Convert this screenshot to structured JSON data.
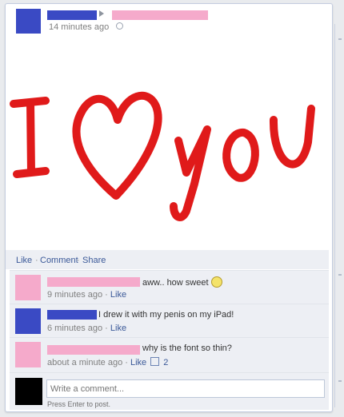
{
  "post": {
    "timestamp": "14 minutes ago",
    "icon_audience": "globe-icon"
  },
  "photo": {
    "drawn_text_left": "I",
    "drawn_text_right": "you",
    "heart_icon": "heart-icon",
    "ink_color": "#e01a1a"
  },
  "actions": {
    "like": "Like",
    "comment": "Comment",
    "share": "Share",
    "separator": "·"
  },
  "comments": [
    {
      "text": "aww.. how sweet",
      "meta_time": "9 minutes ago",
      "meta_like": "Like",
      "emoji": "smiley-icon"
    },
    {
      "text": "I drew it with my penis on my iPad!",
      "meta_time": "6 minutes ago",
      "meta_like": "Like"
    },
    {
      "text": "why is the font so thin?",
      "meta_time": "about a minute ago",
      "meta_like": "Like",
      "like_count": "2"
    }
  ],
  "composer": {
    "placeholder": "Write a comment...",
    "hint": "Press Enter to post."
  },
  "colors": {
    "redaction_blue": "#3a4ac4",
    "redaction_pink": "#f5aacb",
    "link": "#3b5998",
    "background": "#e9ebee"
  }
}
